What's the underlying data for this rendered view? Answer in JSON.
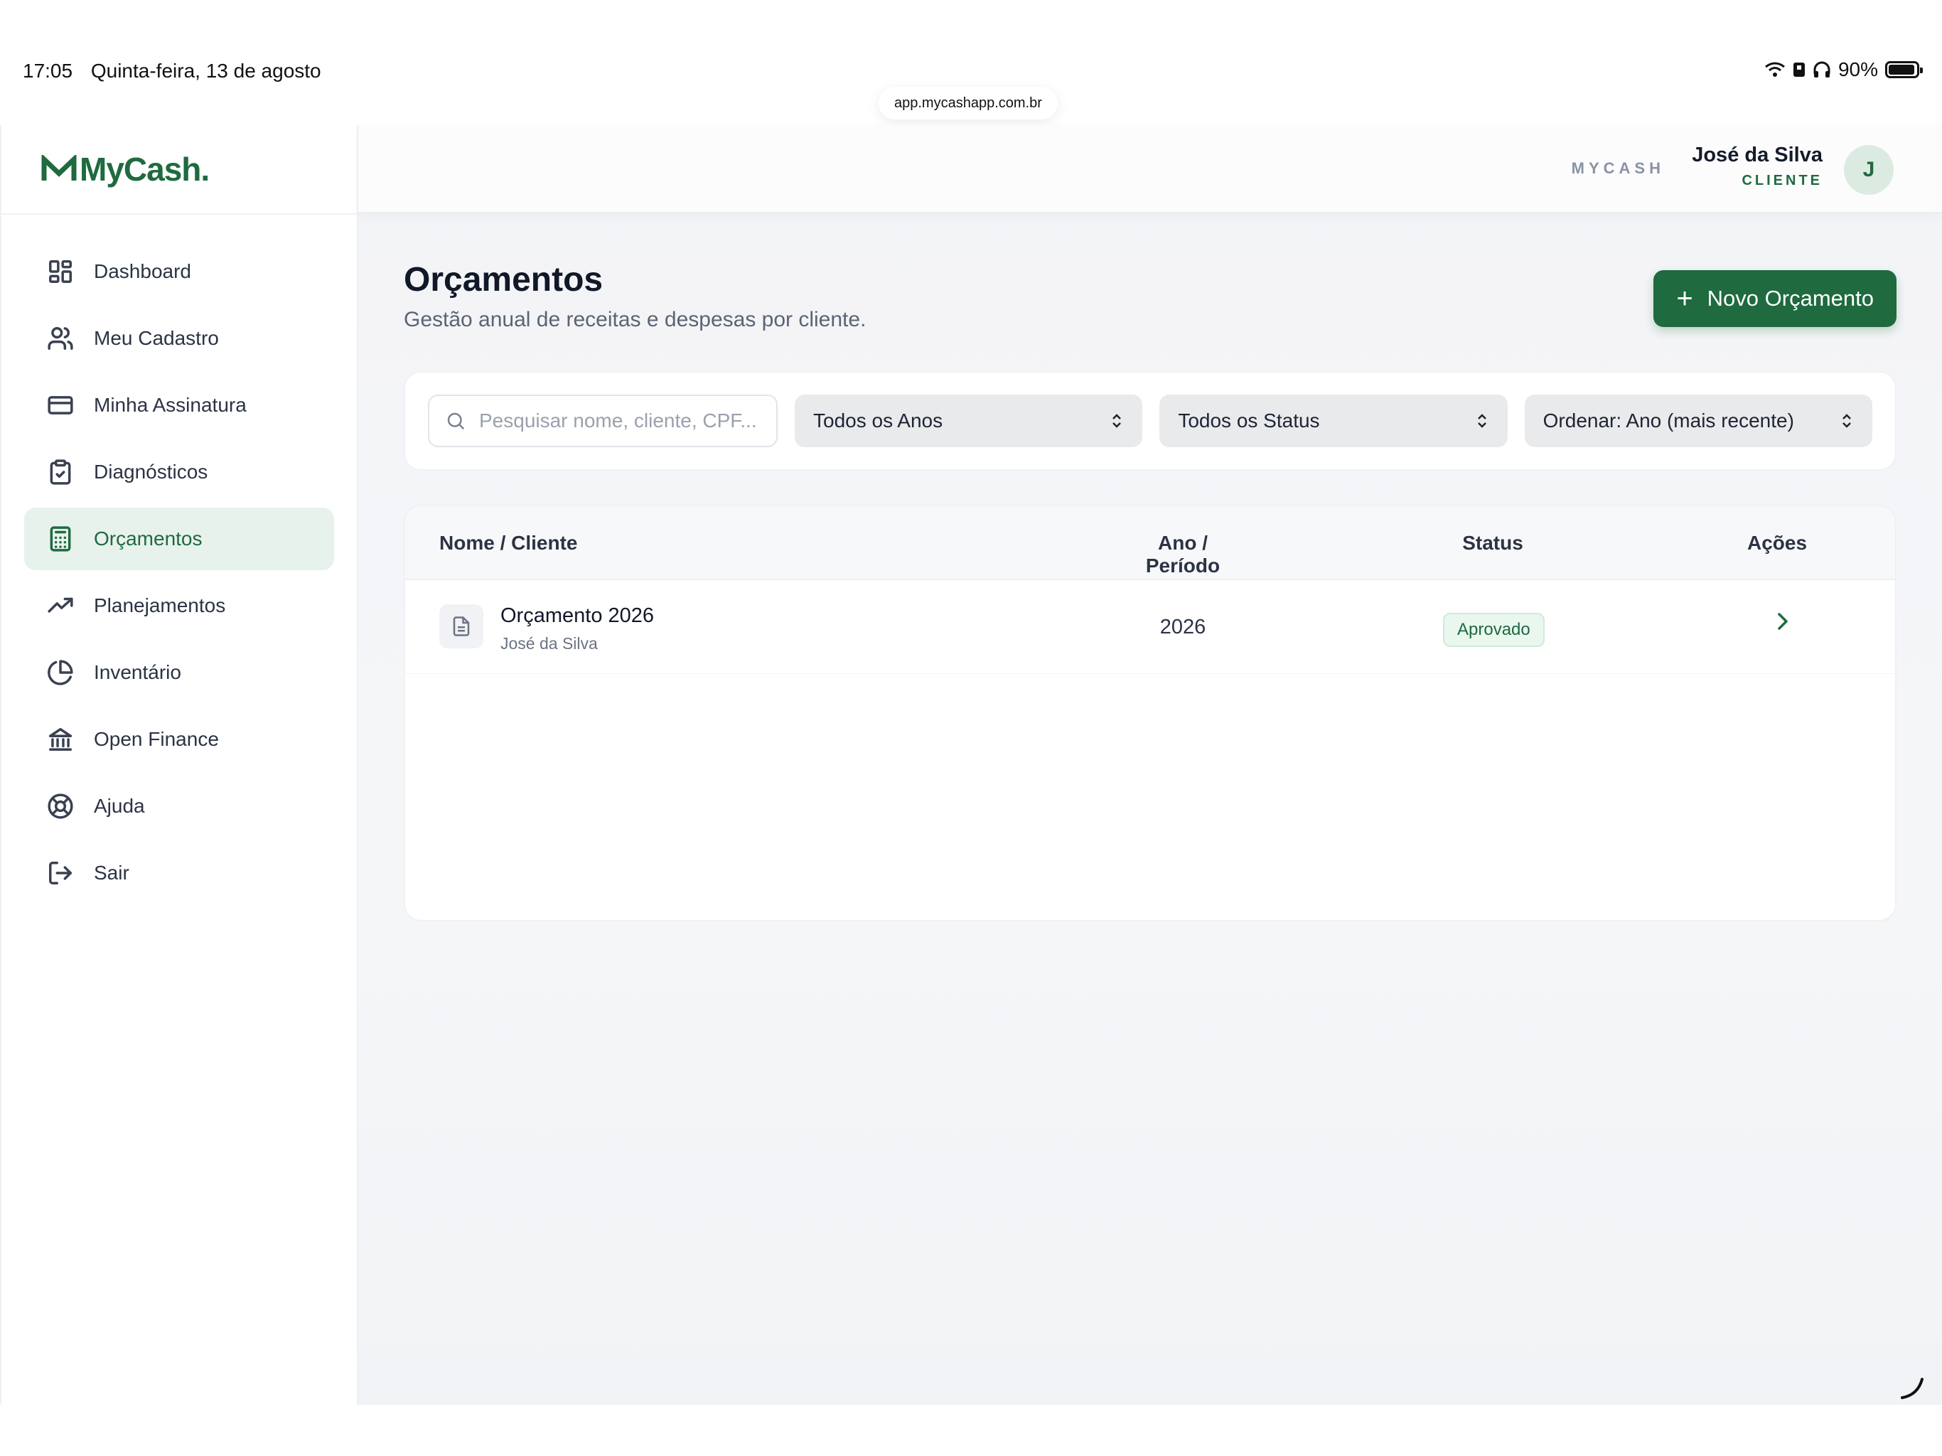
{
  "status_bar": {
    "time": "17:05",
    "date": "Quinta-feira, 13 de agosto",
    "battery": "90%",
    "url": "app.mycashapp.com.br"
  },
  "sidebar": {
    "brand": "MyCash.",
    "items": [
      {
        "label": "Dashboard",
        "icon": "dashboard-icon"
      },
      {
        "label": "Meu Cadastro",
        "icon": "users-icon"
      },
      {
        "label": "Minha Assinatura",
        "icon": "credit-card-icon"
      },
      {
        "label": "Diagnósticos",
        "icon": "clipboard-check-icon"
      },
      {
        "label": "Orçamentos",
        "icon": "calculator-icon",
        "active": true
      },
      {
        "label": "Planejamentos",
        "icon": "trending-up-icon"
      },
      {
        "label": "Inventário",
        "icon": "pie-chart-icon"
      },
      {
        "label": "Open Finance",
        "icon": "bank-icon"
      },
      {
        "label": "Ajuda",
        "icon": "lifebuoy-icon"
      },
      {
        "label": "Sair",
        "icon": "logout-icon"
      }
    ]
  },
  "topbar": {
    "brand": "MYCASH",
    "user_name": "José da Silva",
    "user_role": "CLIENTE",
    "avatar_initial": "J"
  },
  "page": {
    "title": "Orçamentos",
    "subtitle": "Gestão anual de receitas e despesas por cliente.",
    "new_button": "Novo Orçamento"
  },
  "filters": {
    "search_placeholder": "Pesquisar nome, cliente, CPF...",
    "year_select": "Todos os Anos",
    "status_select": "Todos os Status",
    "order_select": "Ordenar: Ano (mais recente)"
  },
  "table": {
    "headers": [
      "Nome / Cliente",
      "Ano / Período",
      "Status",
      "Ações"
    ],
    "rows": [
      {
        "name": "Orçamento 2026",
        "client": "José da Silva",
        "year": "2026",
        "status": "Aprovado"
      }
    ]
  },
  "colors": {
    "accent": "#1f6a3f",
    "active_bg": "#e8f2ec",
    "badge_bg": "#e9f7ef"
  }
}
